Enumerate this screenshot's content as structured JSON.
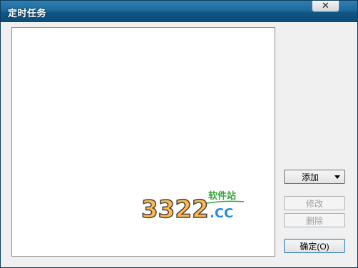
{
  "window": {
    "title": "定时任务"
  },
  "buttons": {
    "close_glyph": "✕",
    "add_label": "添加",
    "edit_label": "修改",
    "delete_label": "删除",
    "ok_label": "确定(O)"
  },
  "watermark": {
    "number": "3322",
    "suffix": ".CC",
    "tagline": "软件站"
  },
  "colors": {
    "titlebar": "#1d6a9b",
    "dialog": "#f0f0f0"
  }
}
